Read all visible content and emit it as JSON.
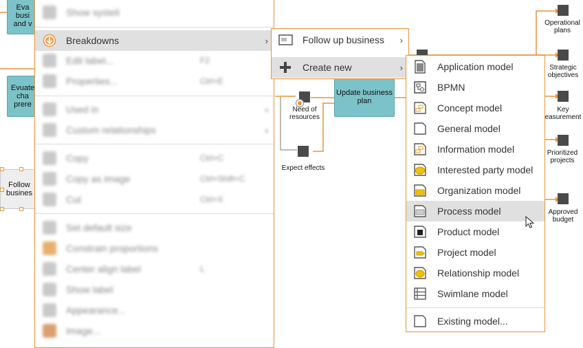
{
  "diagram": {
    "processes": [
      {
        "id": "p1",
        "text": "Eva\nbusi\nand v"
      },
      {
        "id": "p2",
        "text": "Evuate\ncha\nprere"
      },
      {
        "id": "p3",
        "text": "Update business plan"
      }
    ],
    "decision": {
      "text": "Follow\nbusines"
    },
    "events": [
      {
        "id": "e1",
        "text": "Need of resources"
      },
      {
        "id": "e2",
        "text": "Expect effects"
      },
      {
        "id": "e3",
        "text": "Operational plans"
      },
      {
        "id": "e4",
        "text": "Strategic objectives"
      },
      {
        "id": "e5",
        "text": "Key easurement"
      },
      {
        "id": "e6",
        "text": "Prioritized projects"
      },
      {
        "id": "e7",
        "text": "Approved budget"
      }
    ],
    "accent_color": "#e8923a"
  },
  "context_menu": {
    "items": [
      {
        "label": "Show systeli",
        "shortcut": "",
        "blurred": true
      },
      {
        "label": "Breakdowns",
        "shortcut": "",
        "blurred": false,
        "has_submenu": true,
        "highlighted": true
      },
      {
        "label": "Edit label...",
        "shortcut": "F2",
        "blurred": true
      },
      {
        "label": "Properties...",
        "shortcut": "Ctrl+E",
        "blurred": true
      },
      {
        "label": "Used in",
        "shortcut": "",
        "blurred": true,
        "has_submenu": true
      },
      {
        "label": "Custom relationships",
        "shortcut": "",
        "blurred": true,
        "has_submenu": true
      },
      {
        "label": "Copy",
        "shortcut": "Ctrl+C",
        "blurred": true
      },
      {
        "label": "Copy as image",
        "shortcut": "Ctrl+Shift+C",
        "blurred": true
      },
      {
        "label": "Cut",
        "shortcut": "Ctrl+X",
        "blurred": true
      },
      {
        "label": "Set default size",
        "shortcut": "",
        "blurred": true
      },
      {
        "label": "Constrain proportions",
        "shortcut": "",
        "blurred": true
      },
      {
        "label": "Center align label",
        "shortcut": "L",
        "blurred": true
      },
      {
        "label": "Show label",
        "shortcut": "",
        "blurred": true
      },
      {
        "label": "Appearance...",
        "shortcut": "",
        "blurred": true
      },
      {
        "label": "Image...",
        "shortcut": "",
        "blurred": true
      }
    ]
  },
  "breakdowns_submenu": {
    "items": [
      {
        "label": "Follow up business"
      },
      {
        "label": "Create new"
      }
    ],
    "arrow": "›"
  },
  "create_new_submenu": {
    "items": [
      {
        "label": "Application model",
        "icon": "application-model-icon"
      },
      {
        "label": "BPMN",
        "icon": "bpmn-icon"
      },
      {
        "label": "Concept model",
        "icon": "concept-model-icon"
      },
      {
        "label": "General model",
        "icon": "general-model-icon"
      },
      {
        "label": "Information model",
        "icon": "information-model-icon"
      },
      {
        "label": "Interested party model",
        "icon": "interested-party-model-icon"
      },
      {
        "label": "Organization model",
        "icon": "organization-model-icon"
      },
      {
        "label": "Process model",
        "icon": "process-model-icon",
        "highlighted": true
      },
      {
        "label": "Product model",
        "icon": "product-model-icon"
      },
      {
        "label": "Project model",
        "icon": "project-model-icon"
      },
      {
        "label": "Relationship model",
        "icon": "relationship-model-icon"
      },
      {
        "label": "Swimlane model",
        "icon": "swimlane-model-icon"
      },
      {
        "label": "Existing model...",
        "icon": "existing-model-icon"
      }
    ],
    "highlight_color": "#e0e0e0",
    "yellow": "#f2c200"
  }
}
